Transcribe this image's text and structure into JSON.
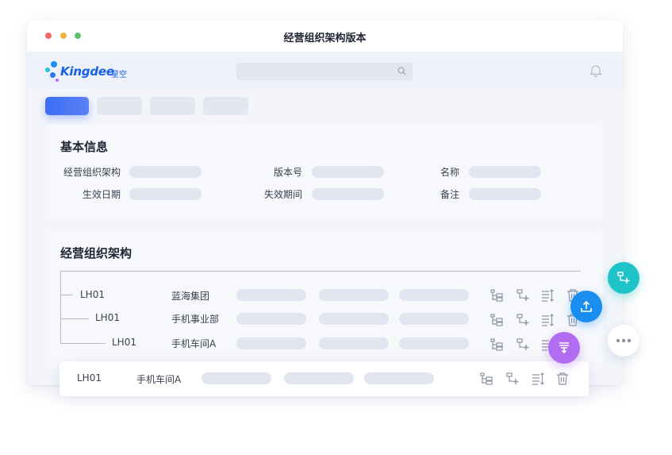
{
  "window": {
    "title": "经营组织架构版本"
  },
  "app": {
    "logo_text": "Kingdee",
    "logo_sub": "星空",
    "logo_icon": "kingdee-logo-icon",
    "search_icon": "search-icon",
    "bell_icon": "bell-icon"
  },
  "basic_info": {
    "title": "基本信息",
    "fields": [
      {
        "label": "经营组织架构"
      },
      {
        "label": "版本号"
      },
      {
        "label": "名称"
      },
      {
        "label": "生效日期"
      },
      {
        "label": "失效期间"
      },
      {
        "label": "备注"
      }
    ]
  },
  "org": {
    "title": "经营组织架构",
    "rows": [
      {
        "code": "LH01",
        "name": "蓝海集团"
      },
      {
        "code": "LH01",
        "name": "手机事业部"
      },
      {
        "code": "LH01",
        "name": "手机车间A"
      }
    ],
    "dragged_row": {
      "code": "LH01",
      "name": "手机车间A"
    },
    "row_action_icons": [
      "org-tree-icon",
      "add-node-icon",
      "sort-icon",
      "trash-icon"
    ]
  },
  "fabs": {
    "add_node_icon": "add-node-icon",
    "upload_icon": "upload-icon",
    "filter_down_icon": "filter-down-icon",
    "more_icon": "more-icon"
  },
  "colors": {
    "primary": "#3c6df3",
    "teal": "#1ec3c8",
    "blue": "#1a8ef0",
    "purple": "#b16cf2",
    "brand": "#1660e8"
  }
}
